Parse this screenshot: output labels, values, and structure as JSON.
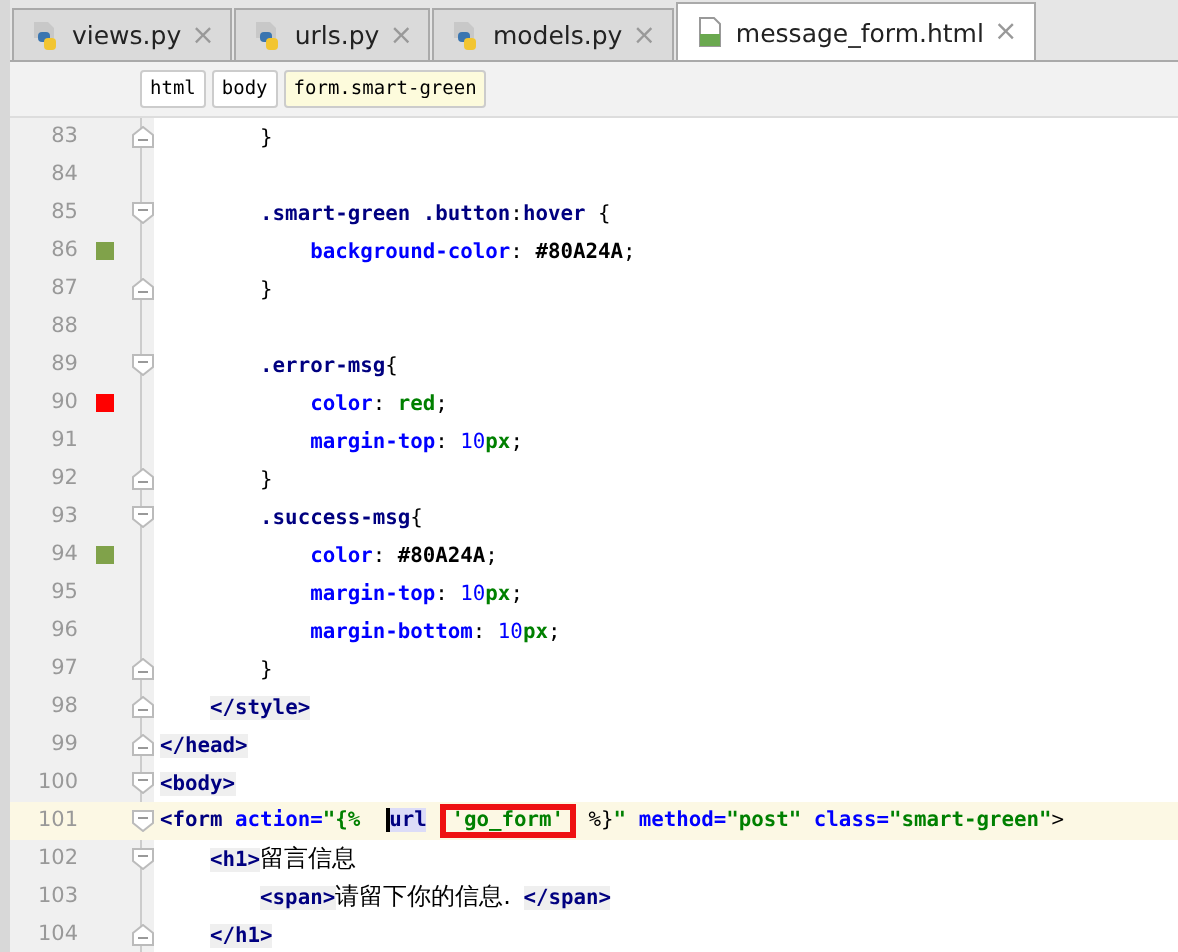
{
  "tabs": [
    {
      "label": "views.py",
      "kind": "python",
      "selected": false,
      "close": "×"
    },
    {
      "label": "urls.py",
      "kind": "python",
      "selected": false,
      "close": "×"
    },
    {
      "label": "models.py",
      "kind": "python",
      "selected": false,
      "close": "×"
    },
    {
      "label": "message_form.html",
      "kind": "html",
      "selected": true,
      "close": "×"
    }
  ],
  "breadcrumbs": [
    {
      "label": "html",
      "selected": false
    },
    {
      "label": "body",
      "selected": false
    },
    {
      "label": "form.smart-green",
      "selected": true
    }
  ],
  "lines": [
    {
      "number": "83",
      "current": false,
      "fold_end": true,
      "tokens": [
        {
          "kind": "p",
          "text": "        }"
        }
      ]
    },
    {
      "number": "84",
      "current": false
    },
    {
      "number": "85",
      "current": false,
      "fold_start": true,
      "tokens": [
        {
          "kind": "sel",
          "text": "        .smart-green .button"
        },
        {
          "kind": "p",
          "text": ":"
        },
        {
          "kind": "sel",
          "text": "hover"
        },
        {
          "kind": "p",
          "text": " {"
        }
      ]
    },
    {
      "number": "86",
      "current": false,
      "color": "#80a24a",
      "tokens": [
        {
          "kind": "prop",
          "text": "            background-color"
        },
        {
          "kind": "p",
          "text": ": "
        },
        {
          "kind": "val",
          "text": "#80A24A"
        },
        {
          "kind": "p",
          "text": ";"
        }
      ]
    },
    {
      "number": "87",
      "current": false,
      "fold_end": true,
      "tokens": [
        {
          "kind": "p",
          "text": "        }"
        }
      ]
    },
    {
      "number": "88",
      "current": false
    },
    {
      "number": "89",
      "current": false,
      "fold_start": true,
      "tokens": [
        {
          "kind": "sel",
          "text": "        .error-msg"
        },
        {
          "kind": "p",
          "text": "{"
        }
      ]
    },
    {
      "number": "90",
      "current": false,
      "color": "#ff0000",
      "tokens": [
        {
          "kind": "prop",
          "text": "            color"
        },
        {
          "kind": "p",
          "text": ": "
        },
        {
          "kind": "str",
          "text": "red"
        },
        {
          "kind": "p",
          "text": ";"
        }
      ]
    },
    {
      "number": "91",
      "current": false,
      "tokens": [
        {
          "kind": "prop",
          "text": "            margin-top"
        },
        {
          "kind": "p",
          "text": ": "
        },
        {
          "kind": "num",
          "text": "10"
        },
        {
          "kind": "str",
          "text": "px"
        },
        {
          "kind": "p",
          "text": ";"
        }
      ]
    },
    {
      "number": "92",
      "current": false,
      "fold_end": true,
      "tokens": [
        {
          "kind": "p",
          "text": "        }"
        }
      ]
    },
    {
      "number": "93",
      "current": false,
      "fold_start": true,
      "tokens": [
        {
          "kind": "sel",
          "text": "        .success-msg"
        },
        {
          "kind": "p",
          "text": "{"
        }
      ]
    },
    {
      "number": "94",
      "current": false,
      "color": "#80a24a",
      "tokens": [
        {
          "kind": "prop",
          "text": "            color"
        },
        {
          "kind": "p",
          "text": ": "
        },
        {
          "kind": "val",
          "text": "#80A24A"
        },
        {
          "kind": "p",
          "text": ";"
        }
      ]
    },
    {
      "number": "95",
      "current": false,
      "tokens": [
        {
          "kind": "prop",
          "text": "            margin-top"
        },
        {
          "kind": "p",
          "text": ": "
        },
        {
          "kind": "num",
          "text": "10"
        },
        {
          "kind": "str",
          "text": "px"
        },
        {
          "kind": "p",
          "text": ";"
        }
      ]
    },
    {
      "number": "96",
      "current": false,
      "tokens": [
        {
          "kind": "prop",
          "text": "            margin-bottom"
        },
        {
          "kind": "p",
          "text": ": "
        },
        {
          "kind": "num",
          "text": "10"
        },
        {
          "kind": "str",
          "text": "px"
        },
        {
          "kind": "p",
          "text": ";"
        }
      ]
    },
    {
      "number": "97",
      "current": false,
      "fold_end": true,
      "tokens": [
        {
          "kind": "p",
          "text": "        }"
        }
      ]
    },
    {
      "number": "98",
      "current": false,
      "fold_end": true,
      "tokens": [
        {
          "kind": "tag",
          "text": "    </style>"
        }
      ]
    },
    {
      "number": "99",
      "current": false,
      "fold_end": true,
      "tokens": [
        {
          "kind": "tag",
          "text": "</head>"
        }
      ]
    },
    {
      "number": "100",
      "current": false,
      "fold_start": true,
      "tokens": [
        {
          "kind": "tag",
          "text": "<body>"
        }
      ]
    },
    {
      "number": "101",
      "current": true,
      "fold_start": true,
      "tokens": [
        {
          "kind": "tagplain",
          "text": "<form"
        },
        {
          "kind": "attr",
          "text": " action="
        },
        {
          "kind": "str",
          "text": "\"{%"
        },
        {
          "kind": "hl",
          "text": "  url"
        },
        {
          "kind": "boxed",
          "text": " 'go_form'"
        },
        {
          "kind": "p",
          "text": " %}"
        },
        {
          "kind": "str",
          "text": "\""
        },
        {
          "kind": "attr",
          "text": " method="
        },
        {
          "kind": "str",
          "text": "\"post\""
        },
        {
          "kind": "attr",
          "text": " class="
        },
        {
          "kind": "str",
          "text": "\"smart-green\""
        },
        {
          "kind": "p",
          "text": ">"
        }
      ]
    },
    {
      "number": "102",
      "current": false,
      "fold_start": true,
      "tokens": [
        {
          "kind": "tag",
          "text": "    <h1>"
        },
        {
          "kind": "cn",
          "text": "留言信息"
        }
      ]
    },
    {
      "number": "103",
      "current": false,
      "tokens": [
        {
          "kind": "tag",
          "text": "        <span>"
        },
        {
          "kind": "cn",
          "text": "请留下你的信息."
        },
        {
          "kind": "tag",
          "text": " </span>"
        }
      ]
    },
    {
      "number": "104",
      "current": false,
      "fold_end": true,
      "tokens": [
        {
          "kind": "tag",
          "text": "    </h1>"
        }
      ]
    }
  ]
}
